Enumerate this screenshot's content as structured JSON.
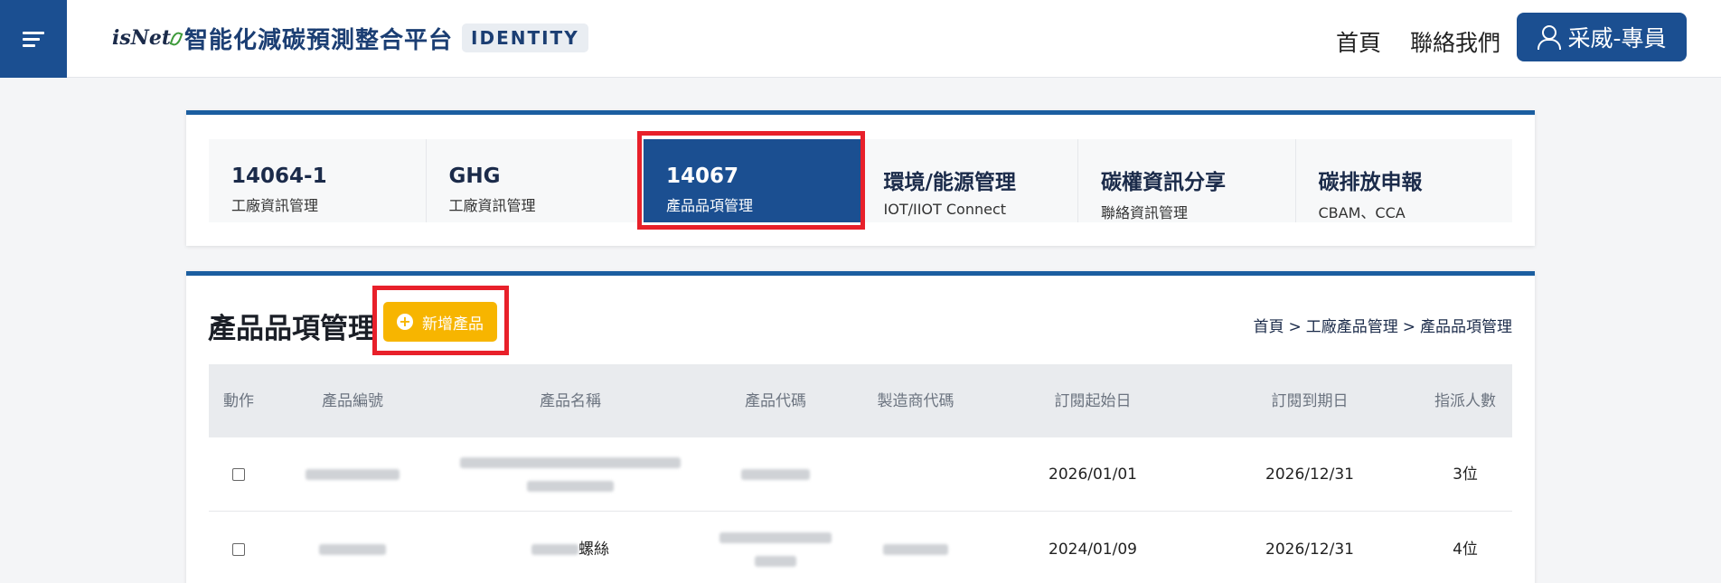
{
  "header": {
    "logo_text": "isNet",
    "app_title": "智能化減碳預測整合平台",
    "badge": "IDENTITY",
    "nav": {
      "home": "首頁",
      "contact": "聯絡我們"
    },
    "user_label": "采威-專員"
  },
  "tabs": [
    {
      "title": "14064-1",
      "subtitle": "工廠資訊管理",
      "active": false
    },
    {
      "title": "GHG",
      "subtitle": "工廠資訊管理",
      "active": false
    },
    {
      "title": "14067",
      "subtitle": "產品品項管理",
      "active": true
    },
    {
      "title": "環境/能源管理",
      "subtitle": "IOT/IIOT Connect",
      "active": false
    },
    {
      "title": "碳權資訊分享",
      "subtitle": "聯絡資訊管理",
      "active": false
    },
    {
      "title": "碳排放申報",
      "subtitle": "CBAM、CCA",
      "active": false
    }
  ],
  "main": {
    "title": "產品品項管理",
    "add_button": "新增產品",
    "breadcrumb": [
      "首頁",
      "工廠產品管理",
      "產品品項管理"
    ],
    "breadcrumb_sep": ">"
  },
  "table": {
    "columns": [
      "動作",
      "產品編號",
      "產品名稱",
      "產品代碼",
      "製造商代碼",
      "訂閱起始日",
      "訂閱到期日",
      "指派人數"
    ],
    "rows": [
      {
        "name_suffix": "",
        "start": "2026/01/01",
        "end": "2026/12/31",
        "count": "3位"
      },
      {
        "name_suffix": "螺絲",
        "start": "2024/01/09",
        "end": "2026/12/31",
        "count": "4位"
      }
    ]
  },
  "colors": {
    "primary": "#1b4f91",
    "accent": "#f7b500",
    "highlight": "#e8202a"
  }
}
